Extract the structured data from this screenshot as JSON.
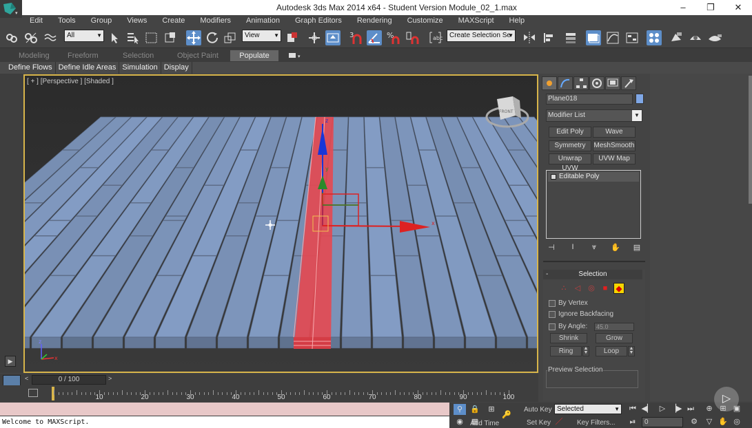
{
  "window": {
    "title": "Autodesk 3ds Max  2014 x64  - Student Version    Module_02_1.max",
    "controls": [
      "–",
      "❐",
      "✕"
    ]
  },
  "menu": [
    "Edit",
    "Tools",
    "Group",
    "Views",
    "Create",
    "Modifiers",
    "Animation",
    "Graph Editors",
    "Rendering",
    "Customize",
    "MAXScript",
    "Help"
  ],
  "toolbar": {
    "selection_filter": "All",
    "reference_coord": "View",
    "named_selection": "Create Selection Se"
  },
  "ribbon": {
    "tabs": [
      "Modeling",
      "Freeform",
      "Selection",
      "Object Paint",
      "Populate"
    ],
    "active_tab": "Populate",
    "sub_items": [
      "Define Flows",
      "Define Idle Areas",
      "Simulation",
      "Display"
    ]
  },
  "viewport": {
    "label": "[ + ] [Perspective ] [Shaded ]",
    "axis_labels": [
      "z",
      "x",
      "y"
    ],
    "viewcube_text": "FRONT"
  },
  "command_panel": {
    "object_name": "Plane018",
    "object_color": "#7fa7e6",
    "modifier_list": "Modifier List",
    "modifier_buttons": [
      "Edit Poly",
      "Wave",
      "Symmetry",
      "MeshSmooth",
      "Unwrap UVW",
      "UVW Map"
    ],
    "stack_item": "Editable Poly",
    "selection_rollout": {
      "title": "Selection",
      "by_vertex": "By Vertex",
      "ignore_backfacing": "Ignore Backfacing",
      "by_angle": "By Angle:",
      "angle_value": "45.0",
      "shrink": "Shrink",
      "grow": "Grow",
      "ring": "Ring",
      "loop": "Loop",
      "preview_selection": "Preview Selection"
    }
  },
  "timeline": {
    "frame_display": "0 / 100",
    "ticks": [
      "10",
      "20",
      "30",
      "40",
      "50",
      "60",
      "70",
      "80",
      "90",
      "100"
    ]
  },
  "maxscript": {
    "listener_text": "Welcome to MAXScript."
  },
  "anim_controls": {
    "auto_key": "Auto Key",
    "set_key": "Set Key",
    "key_mode": "Selected",
    "key_filters": "Key Filters...",
    "add_time_tag": "Add Time",
    "current_frame": "0"
  },
  "colors": {
    "selection_red": "#e34a52",
    "plank_blue": "#8aa5cf",
    "viewport_border": "#d8b54a",
    "active_icon": "#5d8ec9"
  }
}
